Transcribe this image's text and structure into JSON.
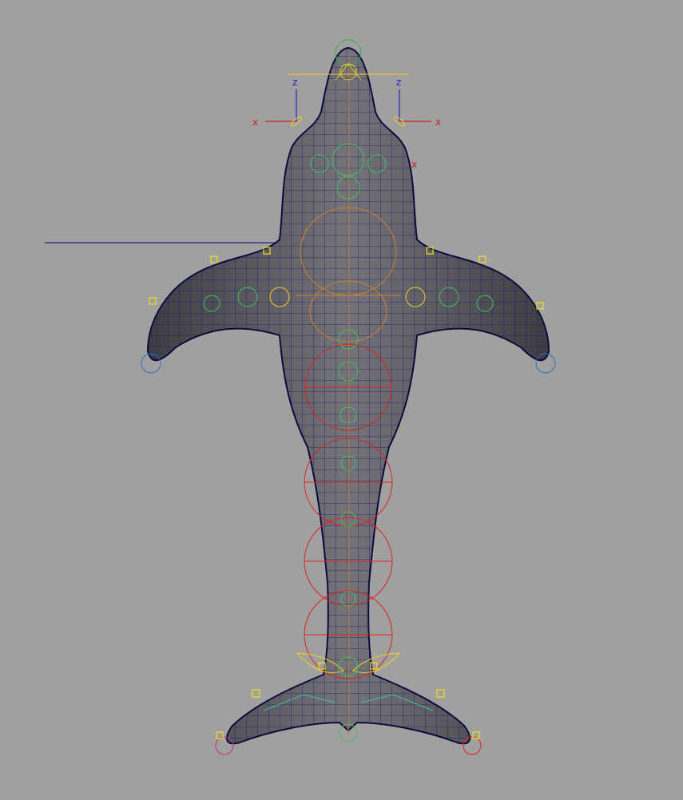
{
  "viewport": {
    "background": "#a0a0a0",
    "mesh_fill": "#5b5b5e",
    "wire_color": "#1a1a66",
    "controls": {
      "fk_color": "#e02020",
      "ik_color": "#f0d020",
      "joint_color": "#40c060",
      "spine_color": "#d08030"
    }
  },
  "gizmos": {
    "left": {
      "x_label": "x",
      "z_label": "z",
      "x_color": "#d02020",
      "z_color": "#2020c0"
    },
    "right": {
      "x_label": "x",
      "z_label": "z",
      "x_color": "#d02020",
      "z_color": "#2020c0"
    },
    "head_x_label": "x"
  },
  "rig": {
    "model": "dolphin"
  }
}
